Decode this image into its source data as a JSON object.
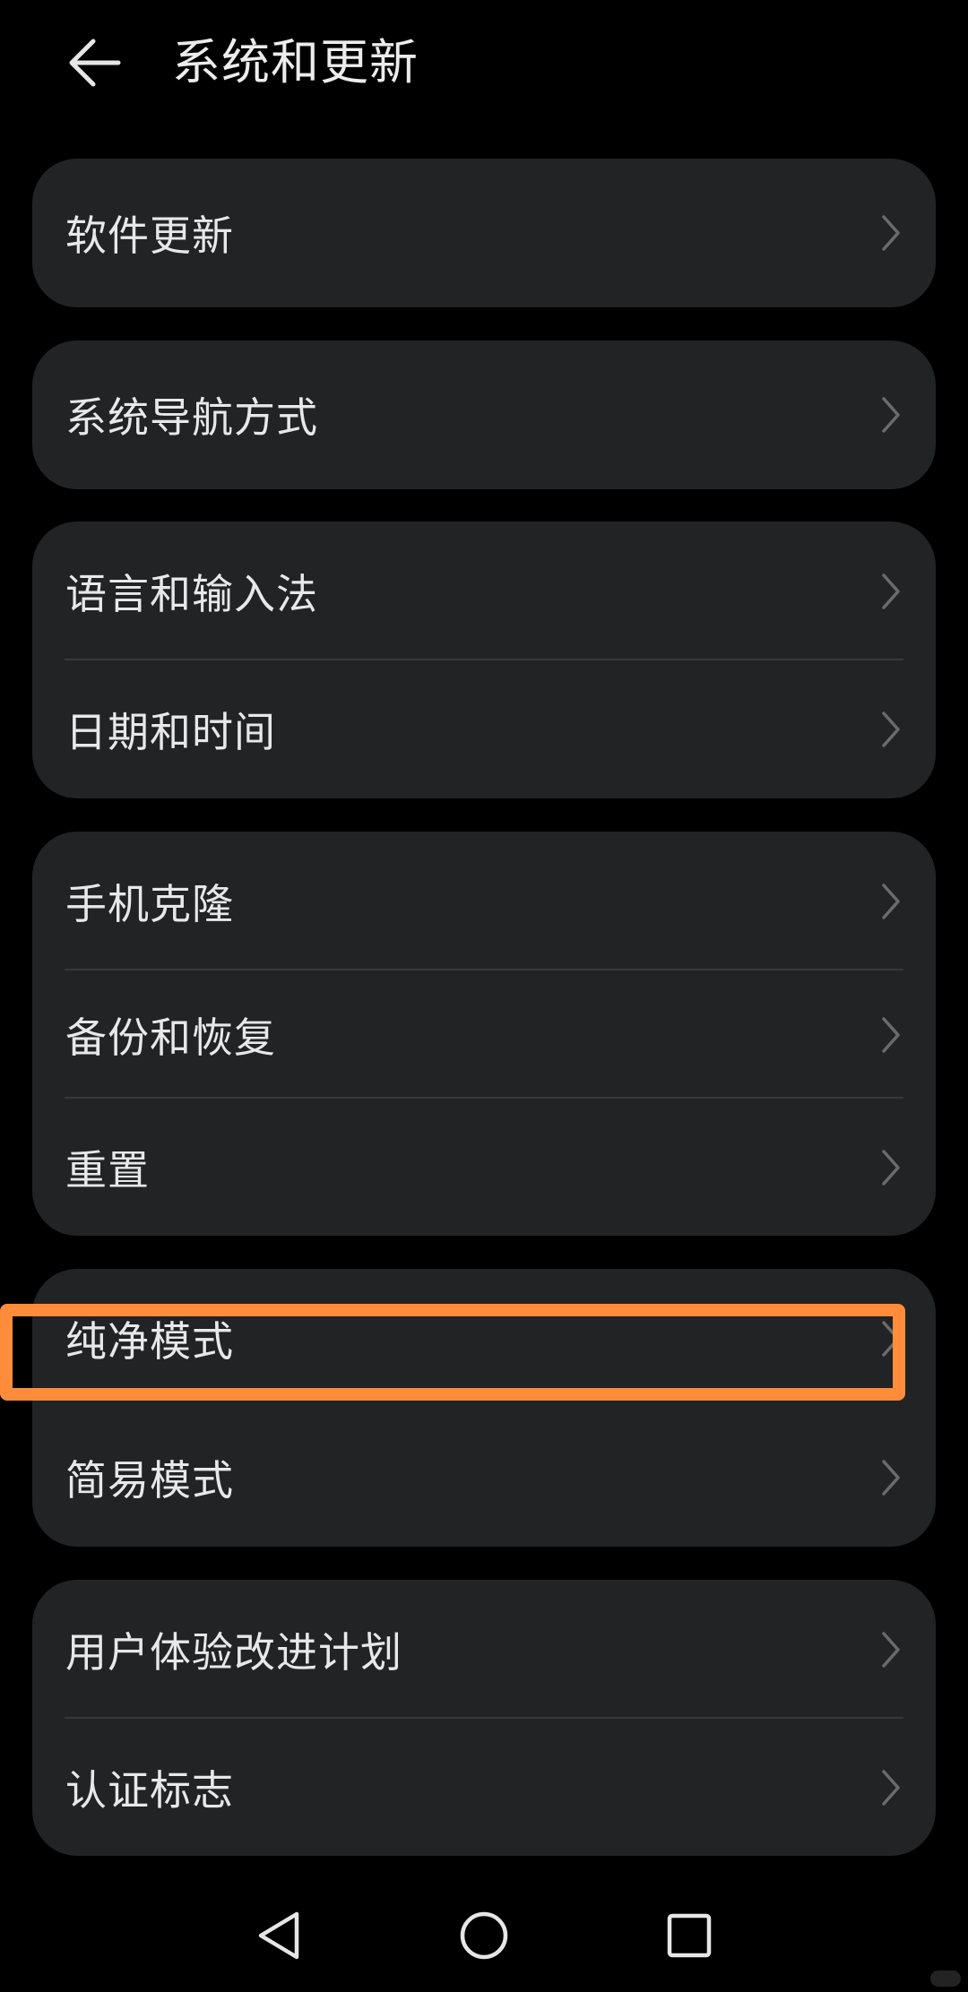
{
  "header": {
    "title": "系统和更新",
    "back_icon": "arrow-left-icon"
  },
  "cards": [
    {
      "items": [
        {
          "label": "软件更新"
        }
      ]
    },
    {
      "items": [
        {
          "label": "系统导航方式"
        }
      ]
    },
    {
      "items": [
        {
          "label": "语言和输入法"
        },
        {
          "label": "日期和时间"
        }
      ]
    },
    {
      "items": [
        {
          "label": "手机克隆"
        },
        {
          "label": "备份和恢复"
        },
        {
          "label": "重置"
        }
      ]
    },
    {
      "items": [
        {
          "label": "纯净模式"
        },
        {
          "label": "简易模式"
        }
      ]
    },
    {
      "items": [
        {
          "label": "用户体验改进计划"
        },
        {
          "label": "认证标志"
        }
      ]
    }
  ],
  "highlight": {
    "target": "纯净模式",
    "color": "#ff8c3a"
  },
  "navbar": {
    "back_icon": "triangle-back-icon",
    "home_icon": "circle-home-icon",
    "recents_icon": "square-recents-icon"
  },
  "colors": {
    "background": "#000000",
    "card": "#222325",
    "divider": "#38393c",
    "text": "#e8e8e8",
    "chevron": "#6b6b6e"
  }
}
